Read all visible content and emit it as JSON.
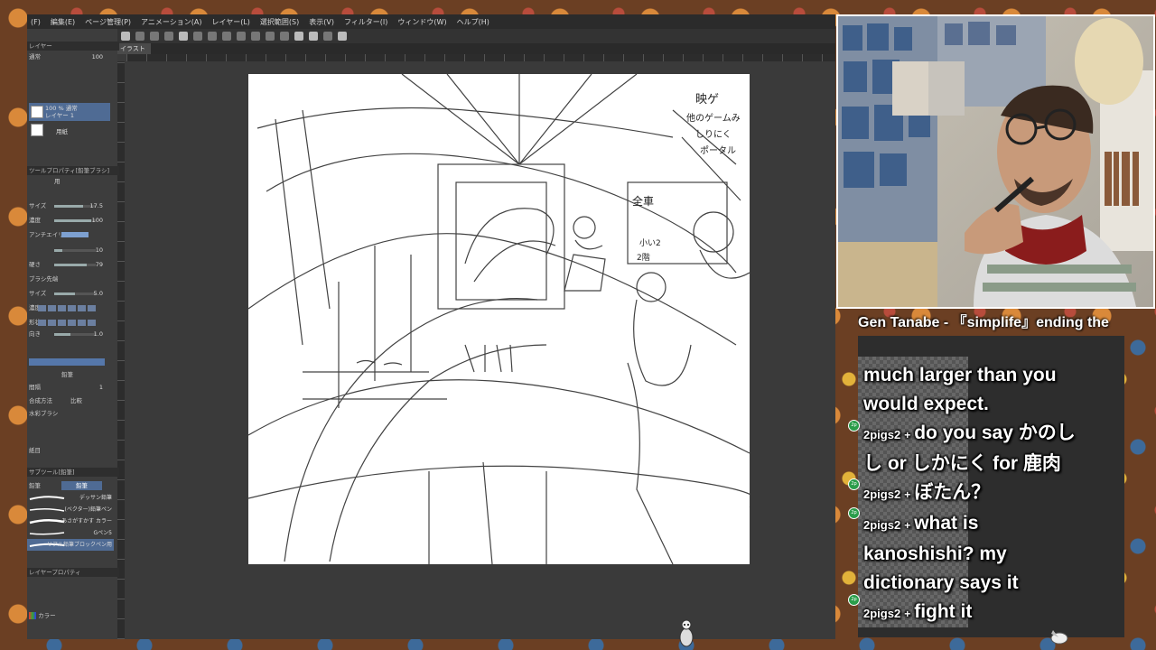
{
  "app": {
    "menu": [
      "(F)",
      "編集(E)",
      "ページ管理(P)",
      "アニメーション(A)",
      "レイヤー(L)",
      "選択範囲(S)",
      "表示(V)",
      "フィルター(I)",
      "ウィンドウ(W)",
      "ヘルプ(H)"
    ],
    "tab_label": "イラスト",
    "layer_panel": {
      "header": "レイヤー",
      "blend_mode": "通常",
      "opacity": "100",
      "layers": [
        {
          "label": "100 % 通常\nレイヤー 1",
          "selected": true
        },
        {
          "label": "用紙",
          "selected": false
        }
      ]
    },
    "tool_property": {
      "header": "ツールプロパティ[鉛筆ブラシ]",
      "preset": "用",
      "rows": [
        {
          "label": "サイズ",
          "value": "17.5"
        },
        {
          "label": "濃度",
          "value": "100"
        },
        {
          "label": "アンチエイリアス",
          "value": ""
        },
        {
          "label": "",
          "value": "10"
        },
        {
          "label": "硬さ",
          "value": "79"
        },
        {
          "label": "ブラシ先端",
          "value": ""
        },
        {
          "label": "サイズ",
          "value": "5.0"
        },
        {
          "label": "濃度",
          "value": ""
        },
        {
          "label": "形状",
          "value": ""
        },
        {
          "label": "向き",
          "value": "1.0"
        }
      ],
      "stroke_label": "鉛筆",
      "blend_label": "比較",
      "brush_label": "合成方法",
      "watercolor": "水彩ブラシ",
      "edge_label": "紙目",
      "spacing_label": "間隔",
      "spacing_value": "1"
    },
    "subtool": {
      "header": "サブツール[鉛筆]",
      "tabs": [
        "鉛筆",
        "鉛筆"
      ],
      "brushes": [
        "デッサン鉛筆",
        "(ベクター)鉛筆ペン",
        "あさがすかす カラー",
        "Gペン5",
        "リアル鉛筆ブロックペン用"
      ]
    },
    "layer_property": "レイヤープロパティ",
    "color_label": "カラー"
  },
  "overlay": {
    "music": "Gen  Tanabe - 『simplife』ending the",
    "chat": [
      {
        "user": "",
        "text": "much larger than you"
      },
      {
        "user": "",
        "text": "would expect."
      },
      {
        "user": "2pigs2",
        "text": "do you say かのし"
      },
      {
        "user": "",
        "text": "し or しかにく for 鹿肉"
      },
      {
        "user": "2pigs2",
        "text": "ぼたん？"
      },
      {
        "user": "2pigs2",
        "text": "what is"
      },
      {
        "user": "",
        "text": "kanoshishi? my"
      },
      {
        "user": "",
        "text": "dictionary says it"
      },
      {
        "user": "2pigs2",
        "text": "fight it"
      }
    ],
    "plus": "+"
  },
  "sketch_notes": {
    "top_right": "映ゲ",
    "line2": "他のゲームみ",
    "line3": "しりにく",
    "line4": "ポータル",
    "label_a": "全車",
    "label_b": "小い2",
    "label_c": "2階"
  }
}
